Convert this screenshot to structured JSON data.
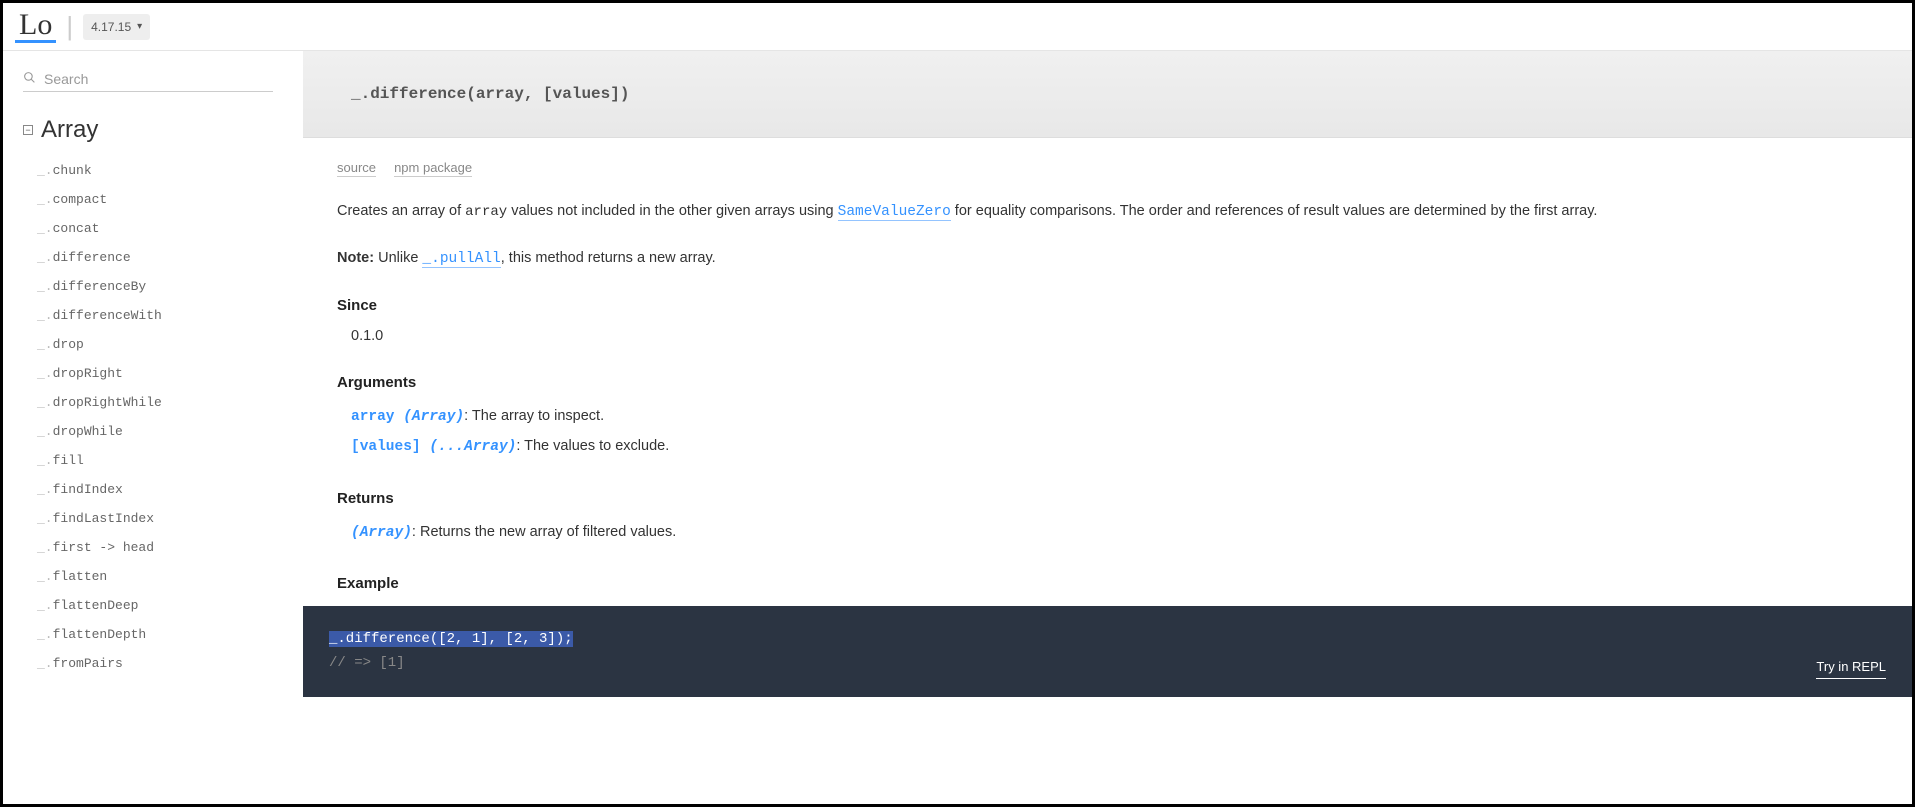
{
  "header": {
    "logo": "Lo",
    "version": "4.17.15"
  },
  "search": {
    "placeholder": "Search"
  },
  "sidebar": {
    "category": "Array",
    "items": [
      {
        "name": "chunk"
      },
      {
        "name": "compact"
      },
      {
        "name": "concat"
      },
      {
        "name": "difference"
      },
      {
        "name": "differenceBy"
      },
      {
        "name": "differenceWith"
      },
      {
        "name": "drop"
      },
      {
        "name": "dropRight"
      },
      {
        "name": "dropRightWhile"
      },
      {
        "name": "dropWhile"
      },
      {
        "name": "fill"
      },
      {
        "name": "findIndex"
      },
      {
        "name": "findLastIndex"
      },
      {
        "name": "first -> head"
      },
      {
        "name": "flatten"
      },
      {
        "name": "flattenDeep"
      },
      {
        "name": "flattenDepth"
      },
      {
        "name": "fromPairs"
      }
    ]
  },
  "doc": {
    "signature": "_.difference(array, [values])",
    "meta": {
      "source": "source",
      "npm": "npm package"
    },
    "desc_pre": "Creates an array of ",
    "desc_code1": "array",
    "desc_mid": " values not included in the other given arrays using ",
    "desc_link": "SameValueZero",
    "desc_post": " for equality comparisons. The order and references of result values are determined by the first array.",
    "note_label": "Note:",
    "note_pre": " Unlike ",
    "note_link": "_.pullAll",
    "note_post": ", this method returns a new array.",
    "since_h": "Since",
    "since_v": "0.1.0",
    "args_h": "Arguments",
    "args": [
      {
        "name": "array",
        "type": " (Array)",
        "desc": ": The array to inspect."
      },
      {
        "name": "[values]",
        "type": " (...Array)",
        "desc": ": The values to exclude."
      }
    ],
    "ret_h": "Returns",
    "ret_type": "(Array)",
    "ret_desc": ": Returns the new array of filtered values.",
    "ex_h": "Example",
    "ex_code": "_.difference([2, 1], [2, 3]);",
    "ex_out": "// => [1]",
    "repl": "Try in REPL"
  }
}
